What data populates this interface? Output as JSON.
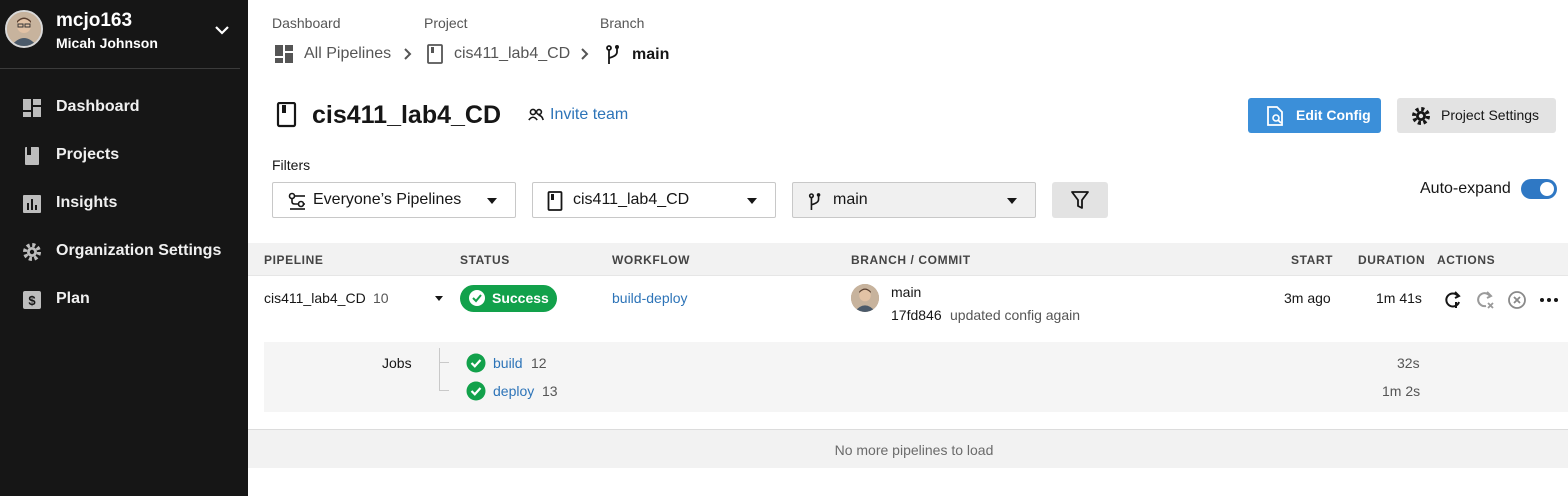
{
  "user": {
    "username": "mcjo163",
    "full_name": "Micah Johnson"
  },
  "sidebar": {
    "items": [
      {
        "label": "Dashboard",
        "icon": "dashboard-icon"
      },
      {
        "label": "Projects",
        "icon": "projects-icon"
      },
      {
        "label": "Insights",
        "icon": "insights-icon"
      },
      {
        "label": "Organization Settings",
        "icon": "gear-icon"
      },
      {
        "label": "Plan",
        "icon": "plan-icon"
      }
    ]
  },
  "breadcrumb": {
    "labels": [
      "Dashboard",
      "Project",
      "Branch"
    ],
    "items": [
      "All Pipelines",
      "cis411_lab4_CD",
      "main"
    ]
  },
  "project": {
    "title": "cis411_lab4_CD",
    "invite_label": "Invite team",
    "edit_config_label": "Edit Config",
    "project_settings_label": "Project Settings"
  },
  "filters": {
    "label": "Filters",
    "pipelines": "Everyone’s Pipelines",
    "project": "cis411_lab4_CD",
    "branch": "main",
    "auto_expand_label": "Auto-expand",
    "auto_expand_on": true
  },
  "table": {
    "headers": [
      "PIPELINE",
      "STATUS",
      "WORKFLOW",
      "BRANCH / COMMIT",
      "START",
      "DURATION",
      "ACTIONS"
    ],
    "row": {
      "pipeline": "cis411_lab4_CD",
      "number": "10",
      "status": "Success",
      "workflow": "build-deploy",
      "branch": "main",
      "commit_hash": "17fd846",
      "commit_message": "updated config again",
      "start": "3m ago",
      "duration": "1m 41s"
    },
    "jobs_label": "Jobs",
    "jobs": [
      {
        "name": "build",
        "number": "12",
        "duration": "32s"
      },
      {
        "name": "deploy",
        "number": "13",
        "duration": "1m 2s"
      }
    ],
    "footer": "No more pipelines to load"
  },
  "colors": {
    "sidebar_bg": "#161616",
    "accent": "#3b8fd9",
    "link": "#2d74b8",
    "success": "#12a14b"
  }
}
